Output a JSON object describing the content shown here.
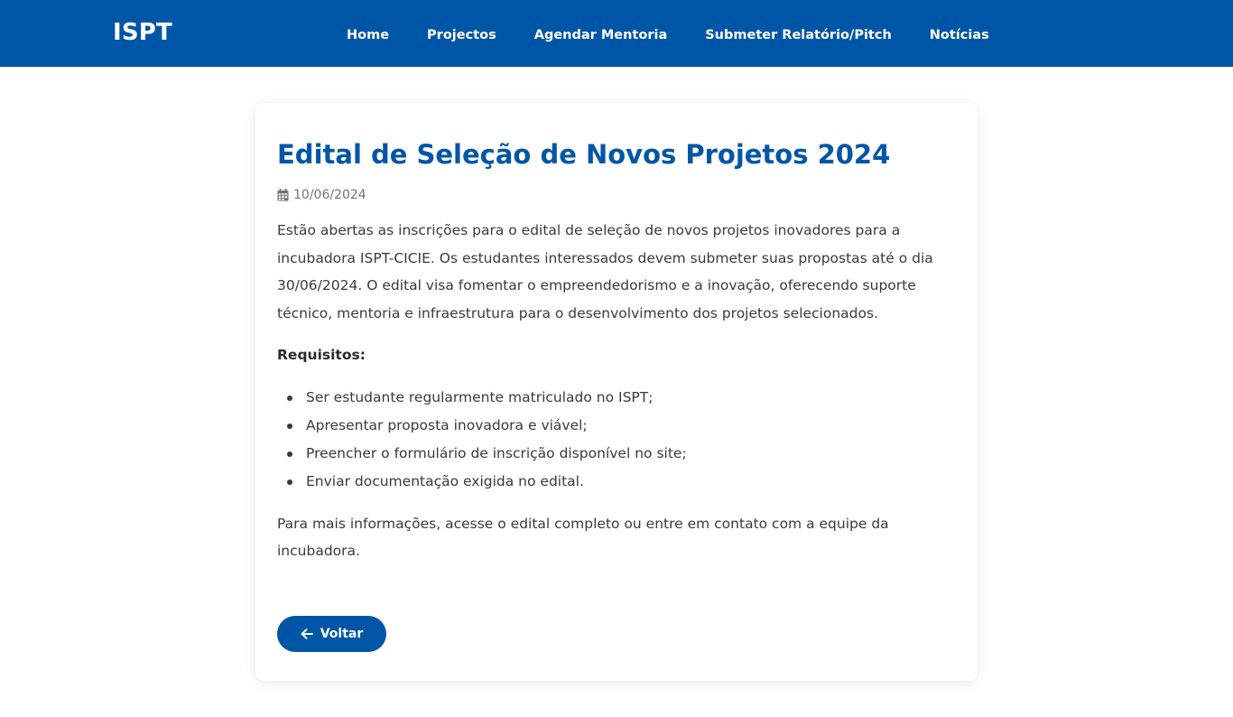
{
  "navbar": {
    "brand": "ISPT",
    "links": [
      {
        "label": "Home"
      },
      {
        "label": "Projectos"
      },
      {
        "label": "Agendar Mentoria"
      },
      {
        "label": "Submeter Relatório/Pitch"
      },
      {
        "label": "Notícias"
      }
    ]
  },
  "article": {
    "title": "Edital de Seleção de Novos Projetos 2024",
    "date": "10/06/2024",
    "intro": "Estão abertas as inscrições para o edital de seleção de novos projetos inovadores para a incubadora ISPT-CICIE. Os estudantes interessados devem submeter suas propostas até o dia 30/06/2024. O edital visa fomentar o empreendedorismo e a inovação, oferecendo suporte técnico, mentoria e infraestrutura para o desenvolvimento dos projetos selecionados.",
    "requirements_title": "Requisitos:",
    "requirements": [
      "Ser estudante regularmente matriculado no ISPT;",
      "Apresentar proposta inovadora e viável;",
      "Preencher o formulário de inscrição disponível no site;",
      "Enviar documentação exigida no edital."
    ],
    "closing": "Para mais informações, acesse o edital completo ou entre em contato com a equipe da incubadora."
  },
  "back_button": {
    "label": "Voltar"
  },
  "icons": {
    "date": "calendar-icon",
    "back": "arrow-left-icon"
  },
  "colors": {
    "primary": "#0056a6",
    "text": "#3a3a3a",
    "muted": "#6c757d"
  }
}
